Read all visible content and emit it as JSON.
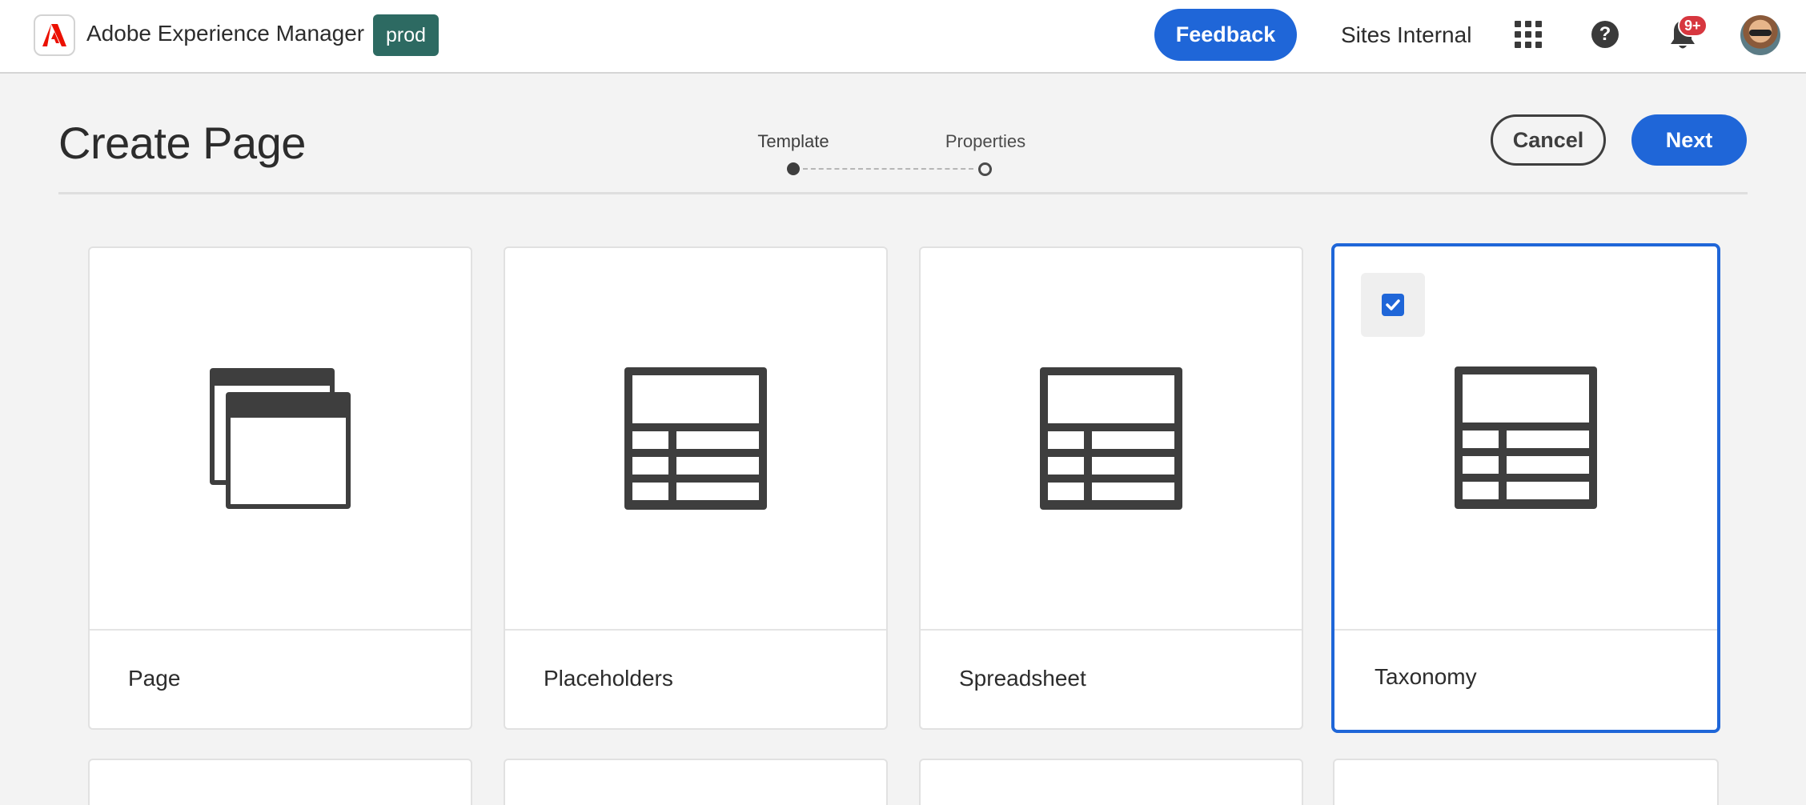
{
  "app": {
    "name": "Adobe Experience Manager",
    "environment": "prod",
    "logo_icon": "adobe-logo-icon",
    "brand_color": "#1f66d8"
  },
  "topbar": {
    "feedback_label": "Feedback",
    "org_label": "Sites Internal",
    "apps_icon": "apps-grid-icon",
    "help_icon": "help-icon",
    "help_glyph": "?",
    "notifications_icon": "bell-icon",
    "notifications_count": "9+"
  },
  "header": {
    "title": "Create Page",
    "steps": [
      {
        "label": "Template",
        "state": "active"
      },
      {
        "label": "Properties",
        "state": "inactive"
      }
    ],
    "cancel_label": "Cancel",
    "next_label": "Next"
  },
  "templates": [
    {
      "label": "Page",
      "icon": "page-template-icon",
      "selected": false
    },
    {
      "label": "Placeholders",
      "icon": "table-template-icon",
      "selected": false
    },
    {
      "label": "Spreadsheet",
      "icon": "table-template-icon",
      "selected": false
    },
    {
      "label": "Taxonomy",
      "icon": "table-template-icon",
      "selected": true
    }
  ]
}
